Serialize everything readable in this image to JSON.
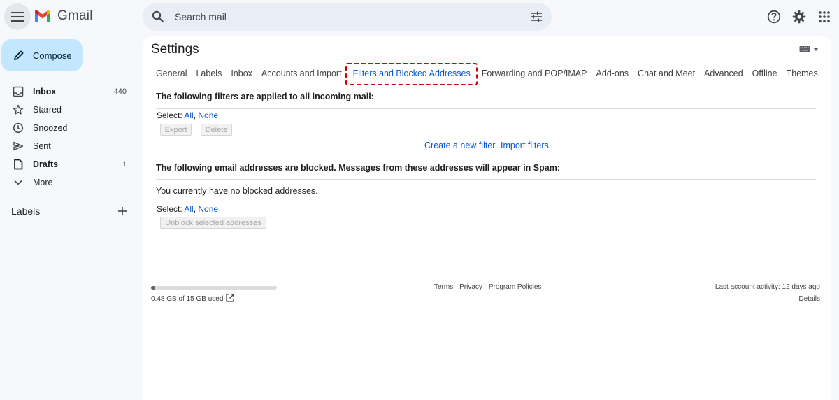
{
  "header": {
    "app_name": "Gmail",
    "search_placeholder": "Search mail",
    "icons": [
      "menu-icon",
      "gmail-logo",
      "search-icon",
      "tune-icon",
      "help-icon",
      "settings-gear-icon",
      "apps-grid-icon"
    ]
  },
  "sidebar": {
    "compose_label": "Compose",
    "items": [
      {
        "label": "Inbox",
        "count": "440",
        "icon": "inbox-icon",
        "bold": true
      },
      {
        "label": "Starred",
        "count": "",
        "icon": "star-icon",
        "bold": false
      },
      {
        "label": "Snoozed",
        "count": "",
        "icon": "clock-icon",
        "bold": false
      },
      {
        "label": "Sent",
        "count": "",
        "icon": "send-icon",
        "bold": false
      },
      {
        "label": "Drafts",
        "count": "1",
        "icon": "draft-icon",
        "bold": true
      },
      {
        "label": "More",
        "count": "",
        "icon": "chevron-down-icon",
        "bold": false
      }
    ],
    "labels_title": "Labels"
  },
  "settings": {
    "title": "Settings",
    "tabs": [
      {
        "label": "General"
      },
      {
        "label": "Labels"
      },
      {
        "label": "Inbox"
      },
      {
        "label": "Accounts and Import"
      },
      {
        "label": "Filters and Blocked Addresses",
        "active": true
      },
      {
        "label": "Forwarding and POP/IMAP"
      },
      {
        "label": "Add-ons"
      },
      {
        "label": "Chat and Meet"
      },
      {
        "label": "Advanced"
      },
      {
        "label": "Offline"
      },
      {
        "label": "Themes"
      }
    ]
  },
  "filters": {
    "heading": "The following filters are applied to all incoming mail:",
    "select_label": "Select:",
    "select_all": "All",
    "select_sep": ",",
    "select_none": "None",
    "export_label": "Export",
    "delete_label": "Delete",
    "create_filter": "Create a new filter",
    "import_filters": "Import filters"
  },
  "blocked": {
    "heading": "The following email addresses are blocked. Messages from these addresses will appear in Spam:",
    "empty_text": "You currently have no blocked addresses.",
    "select_label": "Select:",
    "select_all": "All",
    "select_sep": ",",
    "select_none": "None",
    "unblock_label": "Unblock selected addresses"
  },
  "footer": {
    "storage_text": "0.48 GB of 15 GB used",
    "storage_fraction": 0.032,
    "terms": "Terms",
    "privacy": "Privacy",
    "policies": "Program Policies",
    "sep": " · ",
    "last_activity": "Last account activity: 12 days ago",
    "details": "Details"
  },
  "colors": {
    "accent": "#0b57d0",
    "compose_bg": "#c2e7ff",
    "highlight_box": "#d00000"
  }
}
